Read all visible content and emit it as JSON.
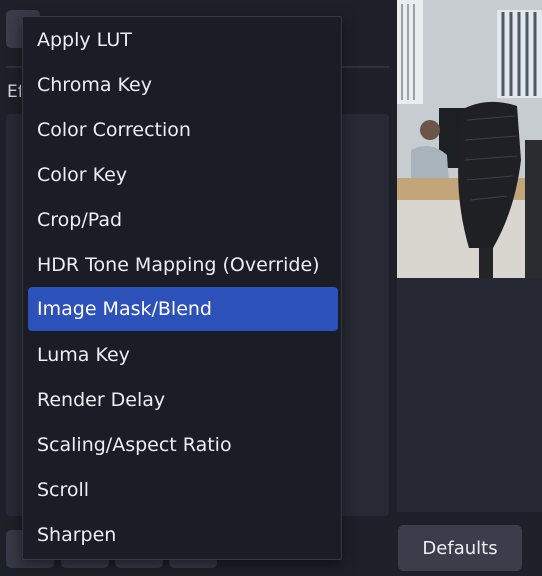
{
  "background": {
    "section_label": "Ef",
    "defaults_button": "Defaults"
  },
  "dropdown": {
    "selected_index": 6,
    "items": [
      {
        "label": "Apply LUT"
      },
      {
        "label": "Chroma Key"
      },
      {
        "label": "Color Correction"
      },
      {
        "label": "Color Key"
      },
      {
        "label": "Crop/Pad"
      },
      {
        "label": "HDR Tone Mapping (Override)"
      },
      {
        "label": "Image Mask/Blend"
      },
      {
        "label": "Luma Key"
      },
      {
        "label": "Render Delay"
      },
      {
        "label": "Scaling/Aspect Ratio"
      },
      {
        "label": "Scroll"
      },
      {
        "label": "Sharpen"
      }
    ]
  },
  "colors": {
    "background": "#1e2029",
    "menu_background": "#1b1d26",
    "selected_highlight": "#2c51b9",
    "button": "#3b3e4a"
  }
}
